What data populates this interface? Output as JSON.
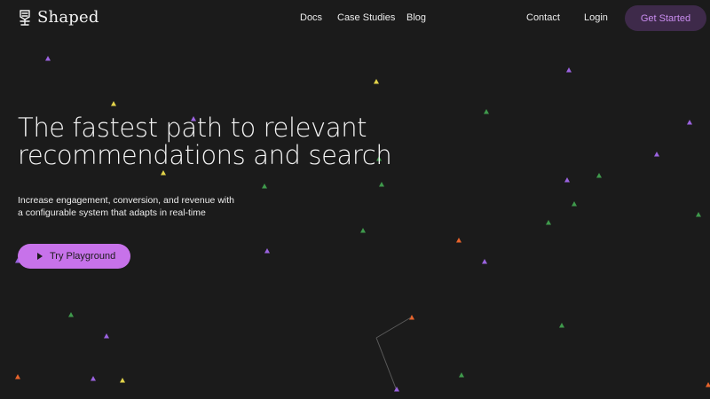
{
  "nav": {
    "brand": "Shaped",
    "links": {
      "docs": "Docs",
      "case_studies": "Case Studies",
      "blog": "Blog",
      "contact": "Contact",
      "login": "Login"
    },
    "cta": "Get Started"
  },
  "hero": {
    "title_line1": "The fastest path to relevant",
    "title_line2": "recommendations and search",
    "subtitle_line1": "Increase engagement, conversion, and revenue with",
    "subtitle_line2": "a configurable system that adapts in real-time",
    "cta": "Try Playground"
  },
  "colors": {
    "background": "#1b1b1b",
    "accent": "#c772ea",
    "cta_bg": "#3e2a4a",
    "cta_text": "#c98cef",
    "particle_purple": "#9b63e0",
    "particle_green": "#3f9a4c",
    "particle_yellow": "#e3d44a",
    "particle_orange": "#e8642c"
  },
  "icons": {
    "brand": "shaped-logo-icon",
    "play": "play-icon"
  }
}
